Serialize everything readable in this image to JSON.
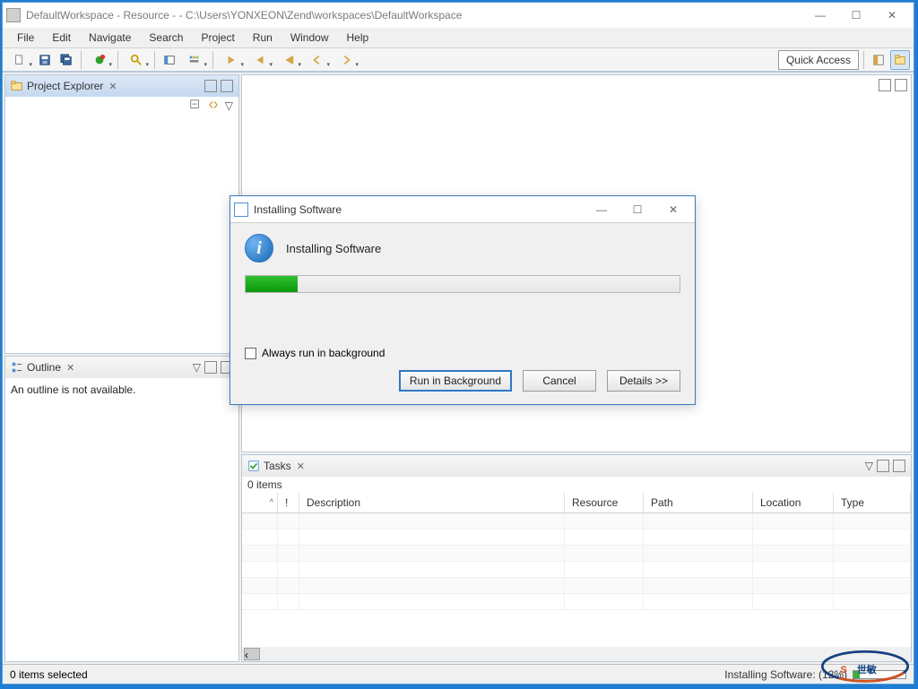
{
  "window": {
    "title": "DefaultWorkspace - Resource -  - C:\\Users\\YONXEON\\Zend\\workspaces\\DefaultWorkspace",
    "controls": {
      "minimize": "—",
      "maximize": "☐",
      "close": "✕"
    }
  },
  "menu": {
    "items": [
      "File",
      "Edit",
      "Navigate",
      "Search",
      "Project",
      "Run",
      "Window",
      "Help"
    ]
  },
  "toolbar": {
    "icons": [
      "new",
      "save",
      "save-all",
      "build",
      "search",
      "toggle",
      "last-edit",
      "back",
      "forward",
      "next-annotation",
      "prev-annotation"
    ],
    "quick_access": "Quick Access"
  },
  "project_explorer": {
    "title": "Project Explorer"
  },
  "outline": {
    "title": "Outline",
    "empty_text": "An outline is not available."
  },
  "tasks": {
    "title": "Tasks",
    "count_label": "0 items",
    "columns": [
      "",
      "!",
      "Description",
      "Resource",
      "Path",
      "Location",
      "Type"
    ]
  },
  "statusbar": {
    "left": "0 items selected",
    "right": "Installing Software: (12%)"
  },
  "dialog": {
    "title": "Installing Software",
    "heading": "Installing Software",
    "progress_percent": 12,
    "checkbox_label": "Always run in background",
    "buttons": {
      "run_bg": "Run in Background",
      "cancel": "Cancel",
      "details": "Details >>"
    },
    "controls": {
      "minimize": "—",
      "maximize": "☐",
      "close": "✕"
    }
  },
  "colors": {
    "accent": "#2f78c2",
    "progress": "#18a018"
  }
}
